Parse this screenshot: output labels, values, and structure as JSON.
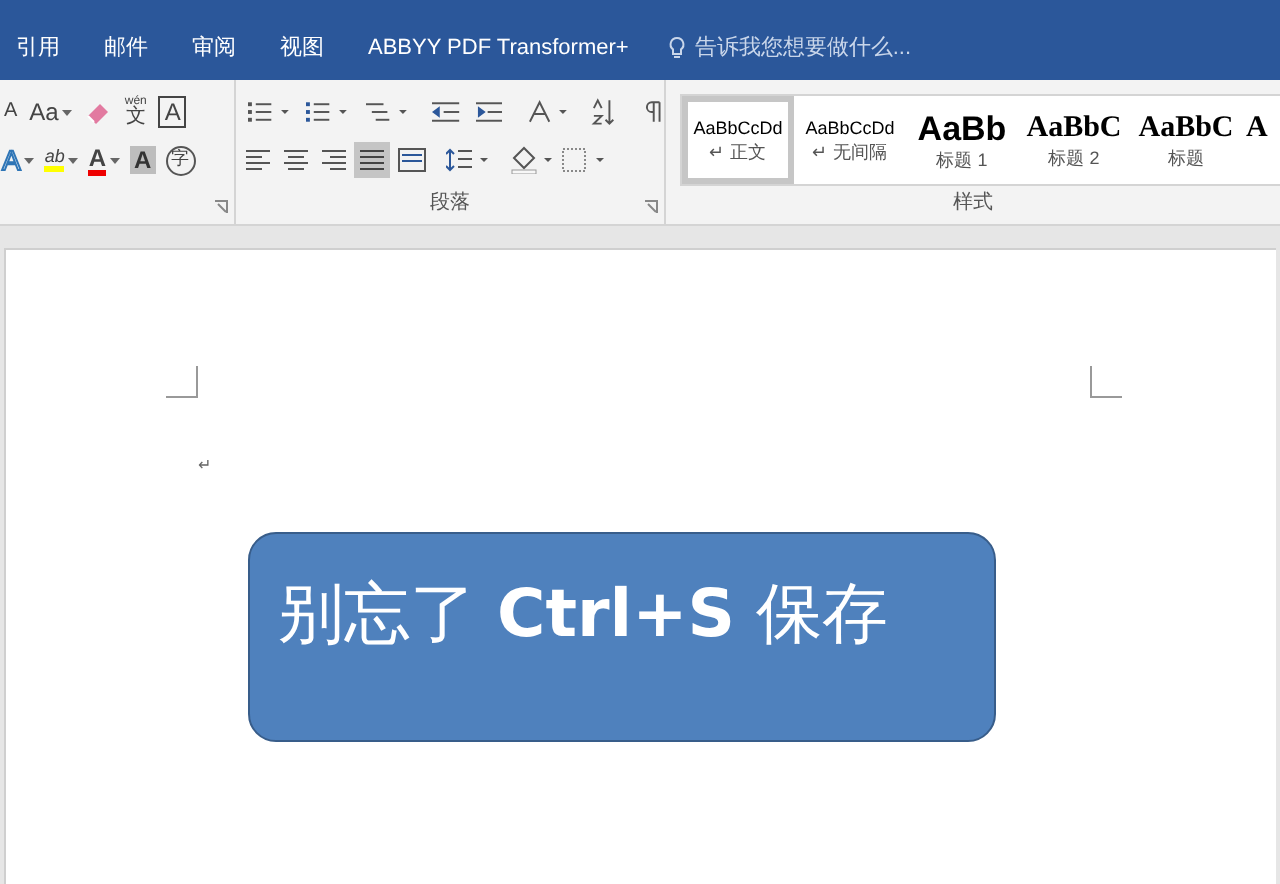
{
  "menu_tabs": [
    {
      "label": "引用"
    },
    {
      "label": "邮件"
    },
    {
      "label": "审阅"
    },
    {
      "label": "视图"
    },
    {
      "label": "ABBYY PDF Transformer+"
    }
  ],
  "tell_me": {
    "placeholder": "告诉我您想要做什么..."
  },
  "font_group": {
    "row_1": [
      {
        "kind": "grow",
        "glyph": "A"
      },
      {
        "kind": "case",
        "glyph": "Aa"
      },
      {
        "kind": "clear"
      },
      {
        "kind": "phonetic",
        "glyph": "wén",
        "glyph_2": "文"
      },
      {
        "kind": "border",
        "glyph": "A"
      }
    ],
    "row_2": [
      {
        "kind": "effects",
        "glyph": "A"
      },
      {
        "kind": "highlight",
        "glyph": "ab"
      },
      {
        "kind": "color",
        "glyph": "A"
      },
      {
        "kind": "shading",
        "glyph": "A"
      },
      {
        "kind": "enclose",
        "glyph": "字"
      }
    ]
  },
  "paragraph_group": {
    "label": "段落"
  },
  "styles_group": {
    "label": "样式",
    "items": [
      {
        "kind": "normal",
        "preview": "AaBbCcDd",
        "name": "↵ 正文",
        "selected": true
      },
      {
        "kind": "nospacing",
        "preview": "AaBbCcDd",
        "name": "↵ 无间隔",
        "selected": false
      },
      {
        "kind": "heading1",
        "preview": "AaBb",
        "name": "标题 1",
        "selected": false
      },
      {
        "kind": "heading2",
        "preview": "AaBbC",
        "name": "标题 2",
        "selected": false
      },
      {
        "kind": "title",
        "preview": "AaBbC",
        "name": "标题",
        "selected": false
      },
      {
        "kind": "title",
        "preview": "A",
        "selected": false
      }
    ]
  },
  "document": {
    "paragraph_mark": "↵",
    "shape_text": "别忘了 **Ctrl+S** 保存"
  }
}
